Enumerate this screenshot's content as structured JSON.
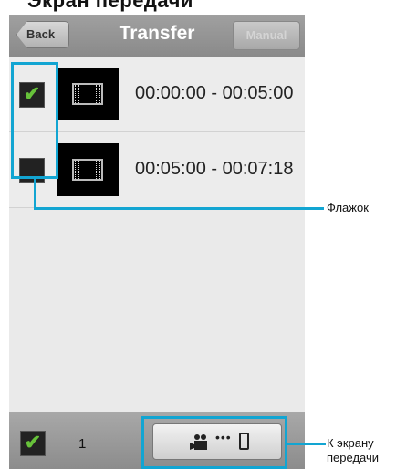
{
  "page_heading": "Экран передачи",
  "header": {
    "back_label": "Back",
    "title": "Transfer",
    "manual_label": "Manual"
  },
  "rows": [
    {
      "checked": true,
      "time_range": "00:00:00 - 00:05:00"
    },
    {
      "checked": false,
      "time_range": "00:05:00 - 00:07:18"
    }
  ],
  "footer": {
    "selected_count": "1"
  },
  "annotations": {
    "checkbox_label": "Флажок",
    "transfer_label_line1": "К экрану",
    "transfer_label_line2": "передачи"
  },
  "check_glyph": "✔",
  "colors": {
    "callout": "#12a5d2",
    "check_green": "#67c23a"
  },
  "icons": [
    "back-arrow",
    "checkmark-icon",
    "film-icon",
    "camcorder-icon",
    "ellipsis-icon",
    "smartphone-icon"
  ]
}
